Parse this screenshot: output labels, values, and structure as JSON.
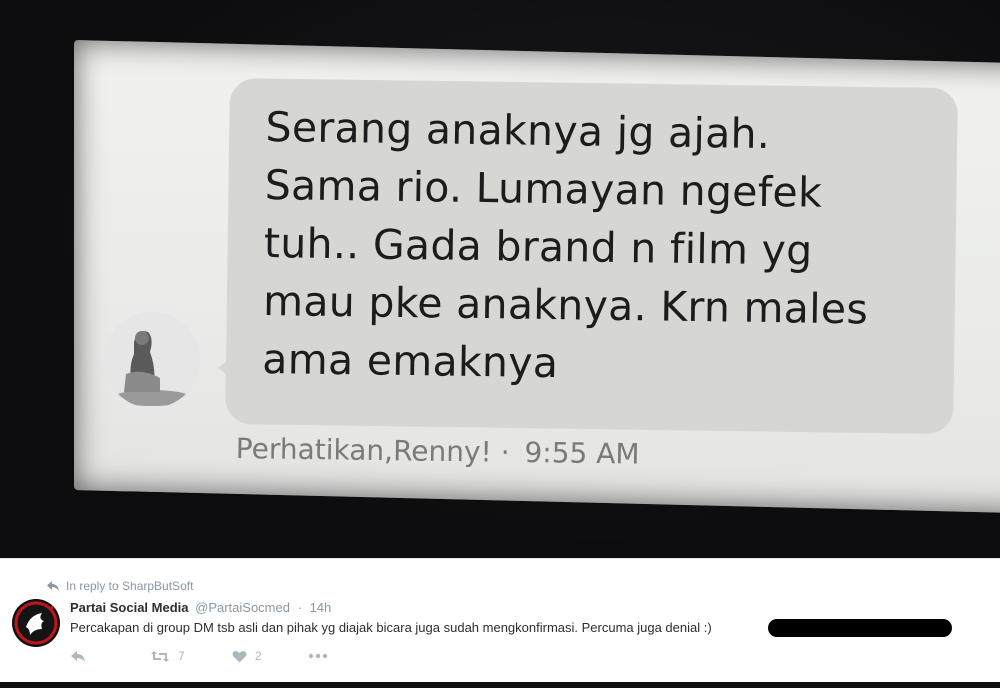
{
  "photo": {
    "message": {
      "text": "Serang anaknya jg ajah.\nSama rio. Lumayan ngefek\ntuh.. Gada brand n film yg\nmau pke anaknya. Krn males\nama emaknya",
      "sender": "Perhatikan,Renny!",
      "separator": "·",
      "time": "9:55 AM"
    },
    "avatar_icon": "person-photo-avatar"
  },
  "tweet": {
    "reply_context": "In reply to SharpButSoft",
    "display_name": "Partai Social Media",
    "handle": "@PartaiSocmed",
    "separator": "·",
    "age": "14h",
    "text": "Percakapan di group DM tsb asli dan pihak yg diajak bicara juga sudah mengkonfirmasi. Percuma juga denial :)",
    "retweet_count": "7",
    "like_count": "2",
    "icons": {
      "reply": "reply-icon",
      "retweet": "retweet-icon",
      "like": "heart-icon",
      "more": "more-icon"
    },
    "colors": {
      "meta": "#8899a6",
      "text": "#292f33",
      "action": "#aab8c2"
    }
  }
}
